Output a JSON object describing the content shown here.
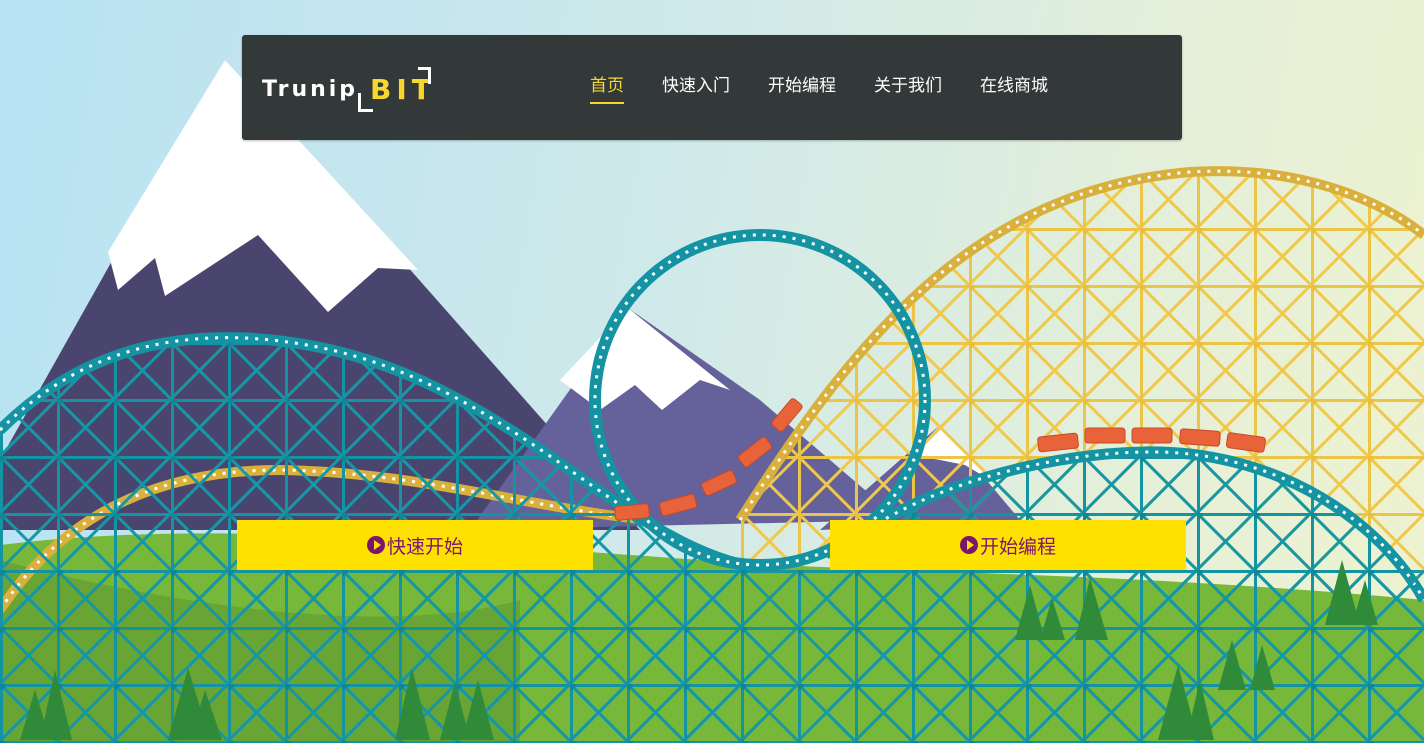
{
  "logo": {
    "word_left": "Trunip",
    "word_right": "BIT"
  },
  "nav": {
    "items": [
      {
        "label": "首页",
        "active": true
      },
      {
        "label": "快速入门",
        "active": false
      },
      {
        "label": "开始编程",
        "active": false
      },
      {
        "label": "关于我们",
        "active": false
      },
      {
        "label": "在线商城",
        "active": false
      }
    ]
  },
  "cta": {
    "quick_start": "快速开始",
    "start_coding": "开始编程"
  },
  "colors": {
    "navbar_bg": "#333838",
    "accent": "#f6d72d",
    "button_bg": "#ffe100",
    "button_text": "#7a1670",
    "teal": "#1493a3",
    "yellow_coaster": "#f0c84a",
    "mountain": "#4a456e",
    "grass": "#77b83a"
  }
}
